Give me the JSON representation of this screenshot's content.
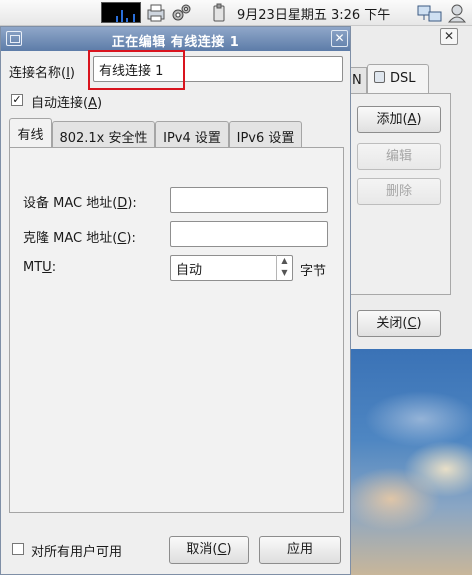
{
  "top_panel": {
    "clock": "9月23日星期五  3:26 下午"
  },
  "background_window": {
    "close_glyph": "✕",
    "tab_partial": "N",
    "tab_dsl": "DSL",
    "add_button": "添加(A)",
    "edit_button": "编辑",
    "delete_button": "删除",
    "close_button": "关闭(C)"
  },
  "dialog": {
    "title": "正在编辑 有线连接 1",
    "close_glyph": "✕",
    "connection_name_label": "连接名称(I)",
    "connection_name_value": "有线连接 1",
    "auto_connect_label": "自动连接(A)",
    "auto_connect_checked": true,
    "tabs": [
      {
        "label": "有线",
        "active": true
      },
      {
        "label": "802.1x 安全性",
        "active": false
      },
      {
        "label": "IPv4 设置",
        "active": false
      },
      {
        "label": "IPv6 设置",
        "active": false
      }
    ],
    "wired": {
      "device_mac_label": "设备 MAC 地址(D):",
      "device_mac_value": "",
      "clone_mac_label": "克隆 MAC 地址(C):",
      "clone_mac_value": "",
      "mtu_label": "MTU:",
      "mtu_value": "自动",
      "mtu_unit": "字节"
    },
    "all_users_label": "对所有用户可用",
    "all_users_checked": false,
    "cancel_button": "取消(C)",
    "apply_button": "应用"
  },
  "colors": {
    "titlebar": "#6f8cb6",
    "highlight": "#d9141e"
  }
}
